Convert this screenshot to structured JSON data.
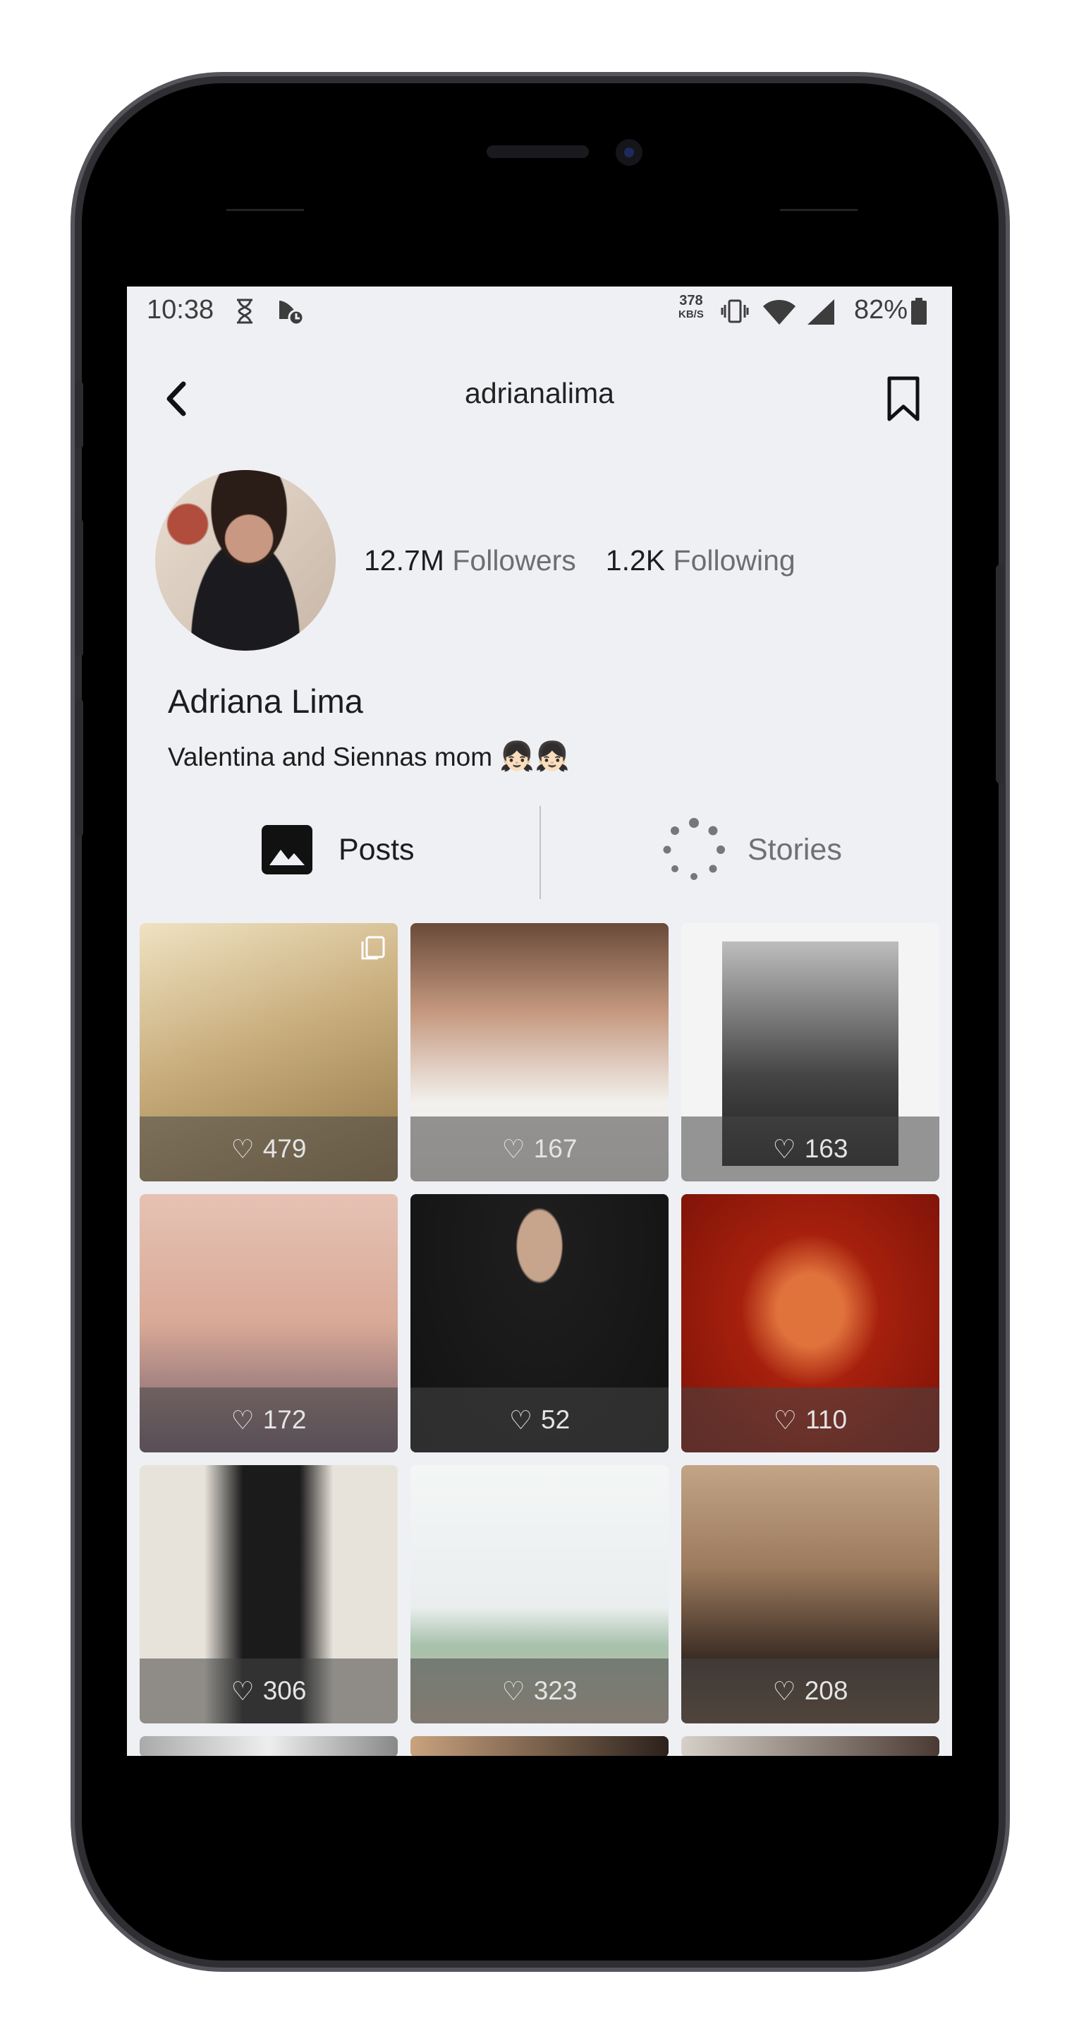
{
  "status_bar": {
    "time": "10:38",
    "net_speed_value": "378",
    "net_speed_unit": "KB/S",
    "battery": "82%"
  },
  "header": {
    "title": "adrianalima",
    "back_icon": "chevron-left-icon",
    "bookmark_icon": "bookmark-icon"
  },
  "profile": {
    "followers_count": "12.7M",
    "followers_label": "Followers",
    "following_count": "1.2K",
    "following_label": "Following",
    "name": "Adriana Lima",
    "bio": "Valentina and Siennas mom",
    "bio_emoji": "👧🏻👧🏻"
  },
  "tabs": [
    {
      "label": "Posts",
      "icon": "image-icon",
      "selected": true
    },
    {
      "label": "Stories",
      "icon": "loading-dots-icon",
      "selected": false
    }
  ],
  "posts": [
    {
      "likes": "479",
      "multi": true
    },
    {
      "likes": "167",
      "multi": false
    },
    {
      "likes": "163",
      "multi": false
    },
    {
      "likes": "172",
      "multi": false
    },
    {
      "likes": "52",
      "multi": false
    },
    {
      "likes": "110",
      "multi": false
    },
    {
      "likes": "306",
      "multi": false
    },
    {
      "likes": "323",
      "multi": false
    },
    {
      "likes": "208",
      "multi": false
    }
  ],
  "colors": {
    "screen_bg": "#eff0f4",
    "text_primary": "#1d1d1d",
    "text_secondary": "#6e6e6e"
  }
}
